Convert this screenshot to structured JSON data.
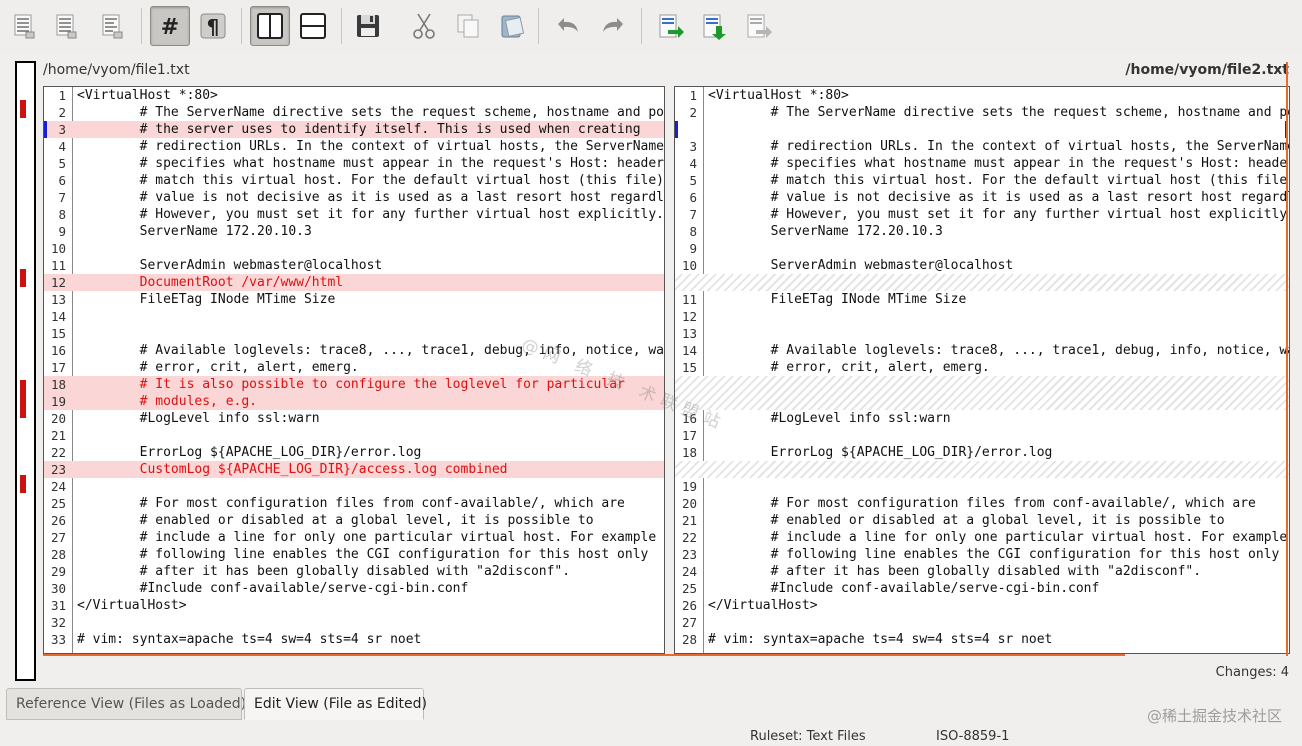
{
  "toolbar": {
    "buttons": [
      {
        "icon": "document-lines-icon"
      },
      {
        "icon": "document-lines-icon-2"
      },
      {
        "icon": "document-lines-icon-3"
      },
      {
        "icon": "hash-icon",
        "label": "#",
        "pressed": true
      },
      {
        "icon": "pilcrow-icon",
        "label": "¶"
      },
      {
        "icon": "split-vertical-icon",
        "pressed": true
      },
      {
        "icon": "split-horizontal-icon"
      },
      {
        "icon": "save-icon"
      },
      {
        "icon": "cut-icon"
      },
      {
        "icon": "copy-icon"
      },
      {
        "icon": "paste-icon"
      },
      {
        "icon": "undo-icon"
      },
      {
        "icon": "redo-icon"
      },
      {
        "icon": "next-diff-icon"
      },
      {
        "icon": "prev-diff-icon"
      },
      {
        "icon": "last-diff-icon"
      }
    ]
  },
  "files": {
    "left_path": "/home/vyom/file1.txt",
    "right_path": "/home/vyom/file2.txt"
  },
  "left_lines": [
    {
      "n": "1",
      "t": "<VirtualHost *:80>"
    },
    {
      "n": "2",
      "t": "        # The ServerName directive sets the request scheme, hostname and port that"
    },
    {
      "n": "3",
      "t": "        # the server uses to identify itself. This is used when creating",
      "s": "current"
    },
    {
      "n": "4",
      "t": "        # redirection URLs. In the context of virtual hosts, the ServerName"
    },
    {
      "n": "5",
      "t": "        # specifies what hostname must appear in the request's Host: header to"
    },
    {
      "n": "6",
      "t": "        # match this virtual host. For the default virtual host (this file) this"
    },
    {
      "n": "7",
      "t": "        # value is not decisive as it is used as a last resort host regardless."
    },
    {
      "n": "8",
      "t": "        # However, you must set it for any further virtual host explicitly."
    },
    {
      "n": "9",
      "t": "        ServerName 172.20.10.3"
    },
    {
      "n": "10",
      "t": ""
    },
    {
      "n": "11",
      "t": "        ServerAdmin webmaster@localhost"
    },
    {
      "n": "12",
      "t": "        DocumentRoot /var/www/html",
      "s": "changed"
    },
    {
      "n": "13",
      "t": "        FileETag INode MTime Size"
    },
    {
      "n": "14",
      "t": ""
    },
    {
      "n": "15",
      "t": ""
    },
    {
      "n": "16",
      "t": "        # Available loglevels: trace8, ..., trace1, debug, info, notice, warn,"
    },
    {
      "n": "17",
      "t": "        # error, crit, alert, emerg."
    },
    {
      "n": "18",
      "t": "        # It is also possible to configure the loglevel for particular",
      "s": "changed"
    },
    {
      "n": "19",
      "t": "        # modules, e.g.",
      "s": "changed"
    },
    {
      "n": "20",
      "t": "        #LogLevel info ssl:warn"
    },
    {
      "n": "21",
      "t": ""
    },
    {
      "n": "22",
      "t": "        ErrorLog ${APACHE_LOG_DIR}/error.log"
    },
    {
      "n": "23",
      "t": "        CustomLog ${APACHE_LOG_DIR}/access.log combined",
      "s": "changed"
    },
    {
      "n": "24",
      "t": ""
    },
    {
      "n": "25",
      "t": "        # For most configuration files from conf-available/, which are"
    },
    {
      "n": "26",
      "t": "        # enabled or disabled at a global level, it is possible to"
    },
    {
      "n": "27",
      "t": "        # include a line for only one particular virtual host. For example the"
    },
    {
      "n": "28",
      "t": "        # following line enables the CGI configuration for this host only"
    },
    {
      "n": "29",
      "t": "        # after it has been globally disabled with \"a2disconf\"."
    },
    {
      "n": "30",
      "t": "        #Include conf-available/serve-cgi-bin.conf"
    },
    {
      "n": "31",
      "t": "</VirtualHost>"
    },
    {
      "n": "32",
      "t": ""
    },
    {
      "n": "33",
      "t": "# vim: syntax=apache ts=4 sw=4 sts=4 sr noet"
    }
  ],
  "right_lines": [
    {
      "n": "1",
      "t": "<VirtualHost *:80>"
    },
    {
      "n": "2",
      "t": "        # The ServerName directive sets the request scheme, hostname and port that"
    },
    {
      "n": "",
      "t": "",
      "s": "cur-right"
    },
    {
      "n": "3",
      "t": "        # redirection URLs. In the context of virtual hosts, the ServerName"
    },
    {
      "n": "4",
      "t": "        # specifies what hostname must appear in the request's Host: header to"
    },
    {
      "n": "5",
      "t": "        # match this virtual host. For the default virtual host (this file) this"
    },
    {
      "n": "6",
      "t": "        # value is not decisive as it is used as a last resort host regardless."
    },
    {
      "n": "7",
      "t": "        # However, you must set it for any further virtual host explicitly."
    },
    {
      "n": "8",
      "t": "        ServerName 172.20.10.3"
    },
    {
      "n": "9",
      "t": ""
    },
    {
      "n": "10",
      "t": "        ServerAdmin webmaster@localhost"
    },
    {
      "n": "",
      "t": "",
      "s": "gap"
    },
    {
      "n": "11",
      "t": "        FileETag INode MTime Size"
    },
    {
      "n": "12",
      "t": ""
    },
    {
      "n": "13",
      "t": ""
    },
    {
      "n": "14",
      "t": "        # Available loglevels: trace8, ..., trace1, debug, info, notice, warn,"
    },
    {
      "n": "15",
      "t": "        # error, crit, alert, emerg."
    },
    {
      "n": "",
      "t": "",
      "s": "gap"
    },
    {
      "n": "",
      "t": "",
      "s": "gap"
    },
    {
      "n": "16",
      "t": "        #LogLevel info ssl:warn"
    },
    {
      "n": "17",
      "t": ""
    },
    {
      "n": "18",
      "t": "        ErrorLog ${APACHE_LOG_DIR}/error.log"
    },
    {
      "n": "",
      "t": "",
      "s": "gap"
    },
    {
      "n": "19",
      "t": ""
    },
    {
      "n": "20",
      "t": "        # For most configuration files from conf-available/, which are"
    },
    {
      "n": "21",
      "t": "        # enabled or disabled at a global level, it is possible to"
    },
    {
      "n": "22",
      "t": "        # include a line for only one particular virtual host. For example the"
    },
    {
      "n": "23",
      "t": "        # following line enables the CGI configuration for this host only"
    },
    {
      "n": "24",
      "t": "        # after it has been globally disabled with \"a2disconf\"."
    },
    {
      "n": "25",
      "t": "        #Include conf-available/serve-cgi-bin.conf"
    },
    {
      "n": "26",
      "t": "</VirtualHost>"
    },
    {
      "n": "27",
      "t": ""
    },
    {
      "n": "28",
      "t": "# vim: syntax=apache ts=4 sw=4 sts=4 sr noet"
    }
  ],
  "watermark": "@网 络 技 术联盟站",
  "changes": "Changes: 4",
  "tabs": [
    "Reference View (Files as Loaded)",
    "Edit View (File as Edited)"
  ],
  "status": {
    "ruleset": "Ruleset: Text Files",
    "encoding": "ISO-8859-1"
  },
  "corner_watermark": "@稀土掘金技术社区",
  "colors": {
    "changed_bg": "#fbd6d6",
    "changed_text": "#dd1111",
    "accent_orange": "#e86a2e",
    "cursor_blue": "#1b1bd8"
  }
}
